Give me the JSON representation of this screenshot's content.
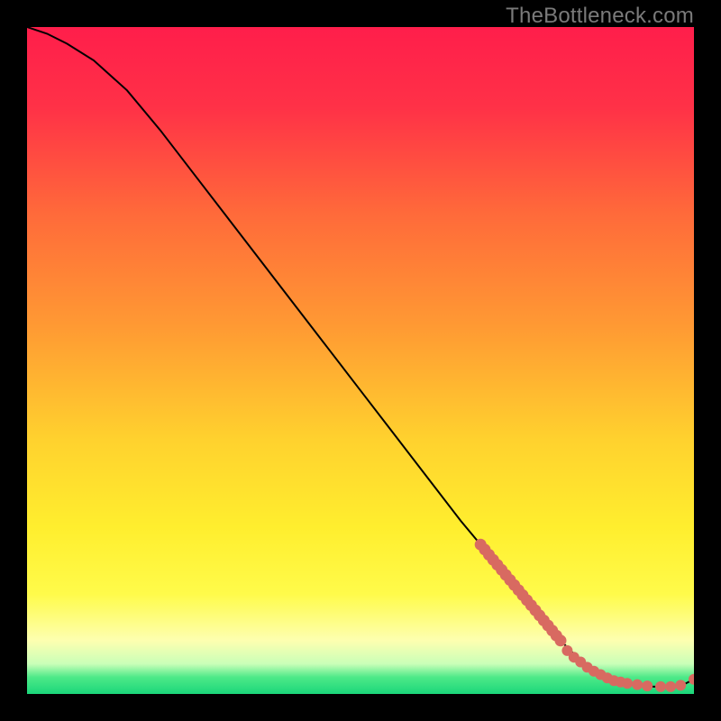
{
  "watermark": "TheBottleneck.com",
  "colors": {
    "gradient_stops": [
      {
        "offset": 0.0,
        "color": "#ff1e4b"
      },
      {
        "offset": 0.12,
        "color": "#ff3147"
      },
      {
        "offset": 0.28,
        "color": "#ff6a3a"
      },
      {
        "offset": 0.45,
        "color": "#ff9a33"
      },
      {
        "offset": 0.62,
        "color": "#ffd22e"
      },
      {
        "offset": 0.75,
        "color": "#ffee2e"
      },
      {
        "offset": 0.85,
        "color": "#fffb4a"
      },
      {
        "offset": 0.92,
        "color": "#fdffb0"
      },
      {
        "offset": 0.955,
        "color": "#c9ffb8"
      },
      {
        "offset": 0.975,
        "color": "#4de988"
      },
      {
        "offset": 1.0,
        "color": "#1bd67a"
      }
    ],
    "curve": "#000000",
    "markers": "#d86a61",
    "background": "#000000"
  },
  "chart_data": {
    "type": "line",
    "title": "",
    "xlabel": "",
    "ylabel": "",
    "xlim": [
      0,
      100
    ],
    "ylim": [
      0,
      100
    ],
    "series": [
      {
        "name": "curve",
        "x": [
          0,
          3,
          6,
          10,
          15,
          20,
          25,
          30,
          35,
          40,
          45,
          50,
          55,
          60,
          65,
          70,
          75,
          80,
          82,
          85,
          88,
          90,
          92,
          94,
          96,
          98,
          100
        ],
        "y": [
          100,
          99,
          97.5,
          95,
          90.5,
          84.5,
          78,
          71.5,
          65,
          58.5,
          52,
          45.5,
          39,
          32.5,
          26,
          20,
          14,
          8,
          6,
          3.5,
          2,
          1.5,
          1.2,
          1.1,
          1.1,
          1.2,
          2.2
        ]
      }
    ],
    "markers": [
      {
        "name": "dense-band",
        "x_range": [
          68,
          80
        ],
        "y_range": [
          22,
          8
        ],
        "count_approx": 20
      },
      {
        "name": "sparse-tail",
        "points": [
          {
            "x": 81,
            "y": 6.5
          },
          {
            "x": 82,
            "y": 5.5
          },
          {
            "x": 83,
            "y": 4.8
          },
          {
            "x": 84,
            "y": 4.0
          },
          {
            "x": 85,
            "y": 3.4
          },
          {
            "x": 86,
            "y": 2.9
          },
          {
            "x": 87,
            "y": 2.4
          },
          {
            "x": 88,
            "y": 2.0
          },
          {
            "x": 89,
            "y": 1.8
          },
          {
            "x": 90,
            "y": 1.6
          },
          {
            "x": 91.5,
            "y": 1.4
          },
          {
            "x": 93,
            "y": 1.2
          },
          {
            "x": 95,
            "y": 1.1
          },
          {
            "x": 96.5,
            "y": 1.1
          },
          {
            "x": 98,
            "y": 1.3
          },
          {
            "x": 100,
            "y": 2.2
          }
        ]
      }
    ]
  }
}
